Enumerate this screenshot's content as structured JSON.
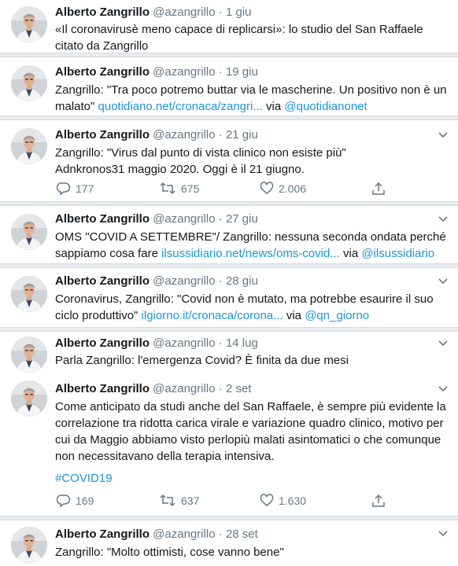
{
  "author": {
    "name": "Alberto Zangrillo",
    "handle": "@azangrillo",
    "separator": "·"
  },
  "tweets": [
    {
      "date": "1 giu",
      "text": "«Il coronavirusè meno capace di replicarsi»: lo studio del San Raffaele citato da Zangrillo"
    },
    {
      "date": "19 giu",
      "text": "Zangrillo: \"Tra poco potremo buttar via le mascherine. Un positivo non è un malato\"",
      "link": "quotidiano.net/cronaca/zangri...",
      "via": "via",
      "mention": "@quotidianonet"
    },
    {
      "date": "21 giu",
      "line1": "Zangrillo: \"Virus dal punto di vista clinico non esiste più\"",
      "line2": "Adnkronos31 maggio 2020. Oggi è il 21 giugno.",
      "replies": "177",
      "retweets": "675",
      "likes": "2.006"
    },
    {
      "date": "27 giu",
      "line1": "OMS \"COVID A SETTEMBRE\"/ Zangrillo: nessuna seconda ondata perché",
      "line2_pre": "sappiamo cosa fare",
      "link": "ilsussidiario.net/news/oms-covid...",
      "via": "via",
      "mention": "@ilsussidiario"
    },
    {
      "date": "28 giu",
      "line1": "Coronavirus, Zangrillo: \"Covid non è mutato, ma potrebbe esaurire il suo",
      "line2_pre": "ciclo produttivo\"",
      "link": "ilgiorno.it/cronaca/corona...",
      "via": "via",
      "mention": "@qn_giorno"
    },
    {
      "date": "14 lug",
      "text": "Parla Zangrillo: l'emergenza Covid? È finita da due mesi"
    },
    {
      "date": "2 set",
      "text": "Come anticipato da studi anche del San Raffaele, è sempre più evidente la correlazione tra ridotta carica virale e variazione quadro clinico, motivo per cui da Maggio abbiamo visto perlopiù malati asintomatici o che comunque non necessitavano della terapia intensiva.",
      "hashtag": "#COVID19",
      "replies": "169",
      "retweets": "637",
      "likes": "1.630"
    },
    {
      "date": "28 set",
      "text": "Zangrillo: \"Molto ottimisti, cose vanno bene\""
    }
  ],
  "icons": {
    "avatar": "profile-photo",
    "chevron": "chevron-down-icon",
    "reply": "reply-icon",
    "retweet": "retweet-icon",
    "like": "heart-icon",
    "share": "share-icon"
  },
  "colors": {
    "link": "#1b95e0",
    "muted": "#657786",
    "text": "#14171a",
    "separator": "#e6ecf0"
  }
}
